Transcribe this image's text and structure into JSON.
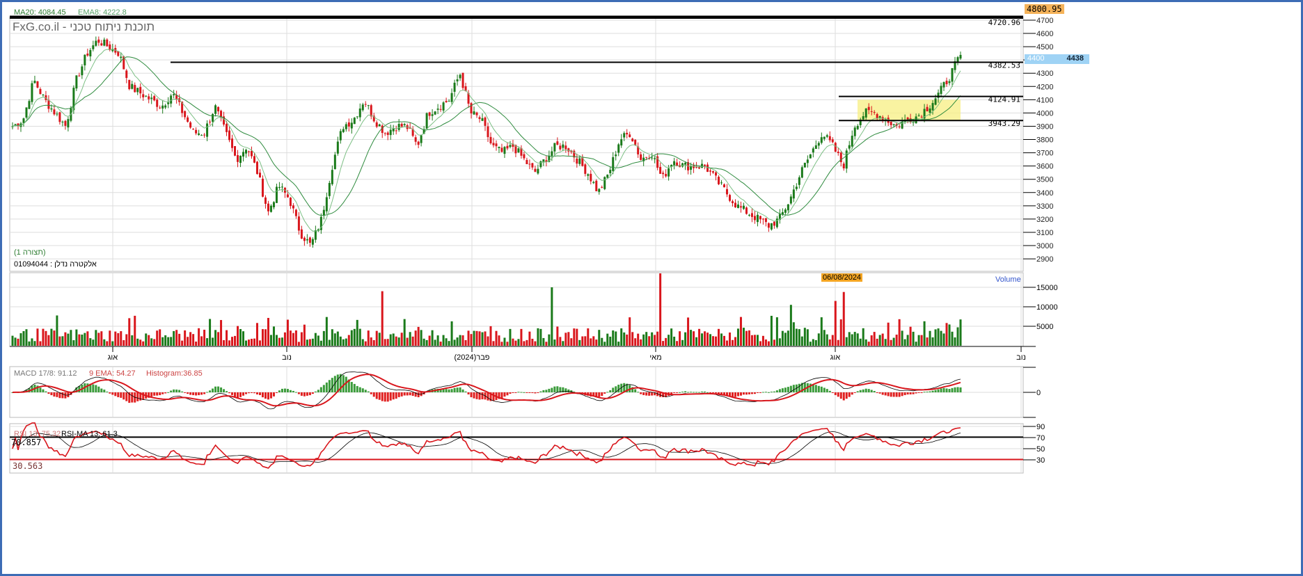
{
  "header": {
    "ma20_label": "MA20: 4084.45",
    "ema8_label": "EMA8: 4222.8",
    "watermark": "FxG.co.il - תוכנת ניתוח טכני",
    "max_price": "4800.95",
    "last_price": "4438",
    "last_price_tick": "4400"
  },
  "instrument": {
    "config": "(תצורה 1)",
    "name": "01094044 : אלקטרה נדלן"
  },
  "levels": [
    {
      "label": "4720.96",
      "value": 4720.96
    },
    {
      "label": "4382.53",
      "value": 4382.53
    },
    {
      "label": "4124.91",
      "value": 4124.91
    },
    {
      "label": "3943.29",
      "value": 3943.29
    }
  ],
  "volume_panel": {
    "title": "Volume",
    "date_badge": "06/08/2024",
    "ticks": [
      "15000",
      "10000",
      "5000"
    ]
  },
  "macd_panel": {
    "macd_label": "MACD 17/8: 91.12",
    "ema_label": "9 EMA: 54.27",
    "hist_label": "Histogram:36.85",
    "zero_tick": "0"
  },
  "rsi_panel": {
    "rsi_label": "RSI 13: 75.32",
    "ma_label": "RSI-MA 13: 61.3",
    "upper": "70.857",
    "lower": "30.563",
    "ticks": [
      "90",
      "70",
      "50",
      "30"
    ]
  },
  "colors": {
    "up": "#1a7a1a",
    "down": "#d9161c",
    "ma": "#2e8b3e",
    "zone": "#f7f08a",
    "badge": "#f5a623",
    "highlight": "#9fd3f5"
  },
  "chart_data": {
    "type": "candlestick",
    "y_ticks": [
      "4700",
      "4600",
      "4500",
      "4400",
      "4300",
      "4200",
      "4100",
      "4000",
      "3900",
      "3800",
      "3700",
      "3600",
      "3500",
      "3400",
      "3300",
      "3200",
      "3100",
      "3000",
      "2900"
    ],
    "ylim": [
      2900,
      4700
    ],
    "x_labels": [
      "אוג",
      "נוב",
      "פבר(2024)",
      "מאי",
      "אוג",
      "נוב"
    ],
    "approx_closes": [
      3900,
      3950,
      4250,
      4100,
      4000,
      3900,
      4250,
      4450,
      4550,
      4500,
      4450,
      4200,
      4150,
      4100,
      4050,
      4150,
      4000,
      3850,
      3850,
      4050,
      3850,
      3650,
      3750,
      3550,
      3250,
      3450,
      3350,
      3100,
      3000,
      3200,
      3600,
      3900,
      3950,
      4100,
      3950,
      3850,
      3900,
      3900,
      3750,
      4000,
      4050,
      4100,
      4300,
      4000,
      3950,
      3750,
      3700,
      3750,
      3650,
      3550,
      3650,
      3750,
      3750,
      3650,
      3550,
      3400,
      3550,
      3800,
      3850,
      3650,
      3700,
      3500,
      3650,
      3600,
      3600,
      3600,
      3500,
      3400,
      3300,
      3250,
      3200,
      3150,
      3200,
      3350,
      3550,
      3700,
      3850,
      3750,
      3600,
      3900,
      4000,
      4000,
      3950,
      3900,
      3950,
      3980,
      4050,
      4150,
      4280,
      4438
    ],
    "volume_spikes": [
      {
        "index": 133,
        "value": 14000
      },
      {
        "index": 194,
        "value": 15000
      },
      {
        "index": 233,
        "value": 19000
      },
      {
        "index": 280,
        "value": 10500
      },
      {
        "index": 296,
        "value": 11500
      },
      {
        "index": 299,
        "value": 13800
      }
    ]
  }
}
